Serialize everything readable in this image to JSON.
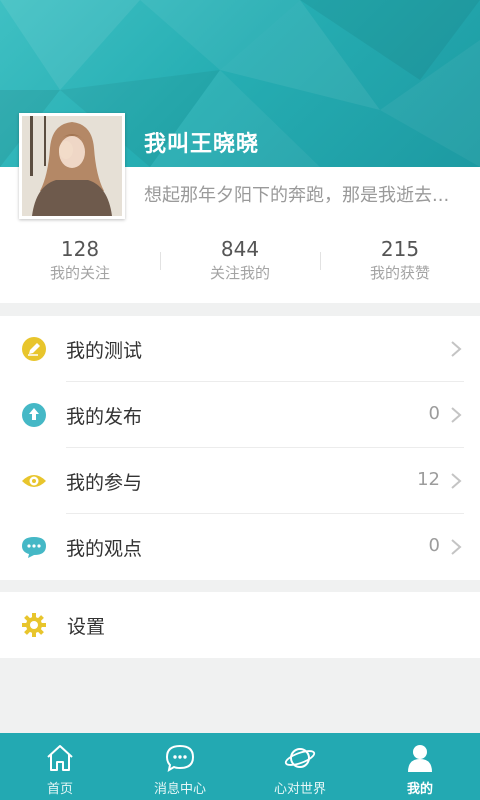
{
  "profile": {
    "username": "我叫王晓晓",
    "bio": "想起那年夕阳下的奔跑，那是我逝去...",
    "stats": [
      {
        "value": "128",
        "label": "我的关注"
      },
      {
        "value": "844",
        "label": "关注我的"
      },
      {
        "value": "215",
        "label": "我的获赞"
      }
    ]
  },
  "menu": [
    {
      "label": "我的测试",
      "count": "",
      "icon": "pencil-icon",
      "color": "#e8c52c"
    },
    {
      "label": "我的发布",
      "count": "0",
      "icon": "upload-icon",
      "color": "#45b8c6"
    },
    {
      "label": "我的参与",
      "count": "12",
      "icon": "eye-icon",
      "color": "#e8c52c"
    },
    {
      "label": "我的观点",
      "count": "0",
      "icon": "chat-icon",
      "color": "#45b8c6"
    }
  ],
  "settings": {
    "label": "设置",
    "icon": "gear-icon",
    "color": "#e8c52c"
  },
  "tabbar": {
    "tabs": [
      {
        "label": "首页",
        "icon": "home-icon"
      },
      {
        "label": "消息中心",
        "icon": "message-icon"
      },
      {
        "label": "心对世界",
        "icon": "planet-icon"
      },
      {
        "label": "我的",
        "icon": "person-icon"
      }
    ],
    "active": "我的"
  },
  "colors": {
    "accent": "#23a9b2",
    "header": "#2bb3b7",
    "icon_yellow": "#e8c52c",
    "icon_teal": "#45b8c6"
  }
}
